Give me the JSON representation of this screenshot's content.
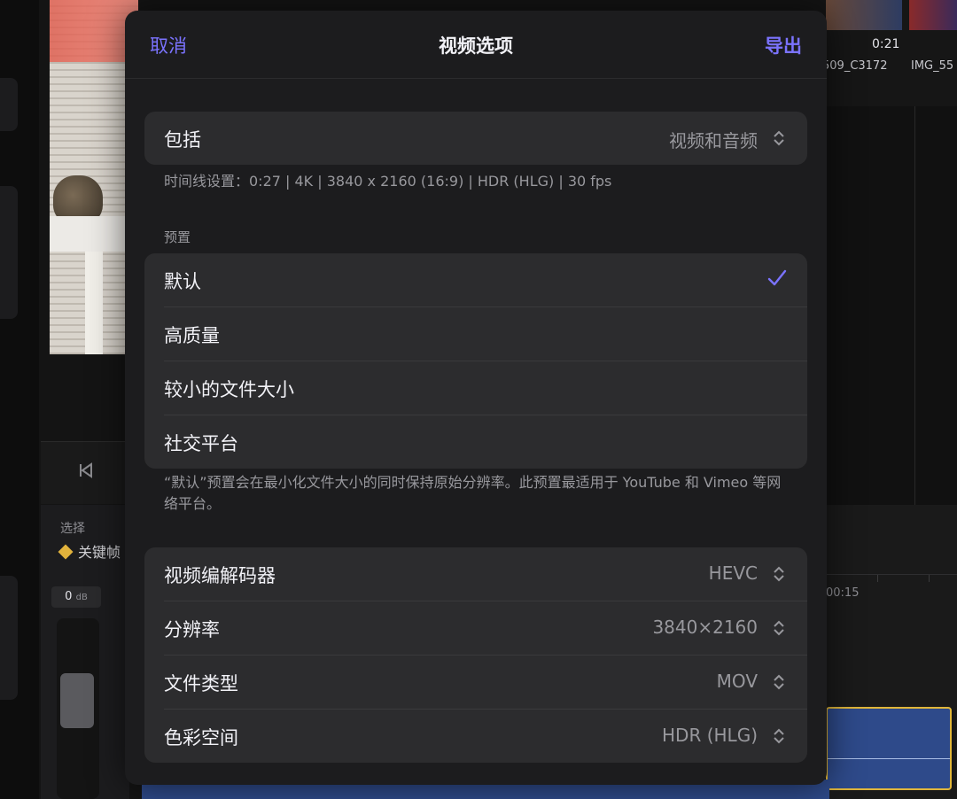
{
  "background": {
    "keyframe_label": "选择",
    "keyframe_text": "关键帧",
    "db_value": "0",
    "db_unit": "dB",
    "clip_duration": "0:21",
    "clip_name_1": "509_C3172",
    "clip_name_2": "IMG_55",
    "timecode": "00:15"
  },
  "dialog": {
    "cancel_label": "取消",
    "title": "视频选项",
    "export_label": "导出",
    "include": {
      "label": "包括",
      "value": "视频和音频"
    },
    "timeline_settings": "时间线设置：0:27 | 4K | 3840 x 2160 (16:9) | HDR (HLG) | 30 fps",
    "preset_header": "预置",
    "presets": [
      {
        "label": "默认",
        "selected": true
      },
      {
        "label": "高质量",
        "selected": false
      },
      {
        "label": "较小的文件大小",
        "selected": false
      },
      {
        "label": "社交平台",
        "selected": false
      }
    ],
    "preset_description": "“默认”预置会在最小化文件大小的同时保持原始分辨率。此预置最适用于 YouTube 和 Vimeo 等网络平台。",
    "settings": [
      {
        "label": "视频编解码器",
        "value": "HEVC"
      },
      {
        "label": "分辨率",
        "value": "3840×2160"
      },
      {
        "label": "文件类型",
        "value": "MOV"
      },
      {
        "label": "色彩空间",
        "value": "HDR (HLG)"
      }
    ]
  },
  "colors": {
    "accent": "#7b73ff",
    "dialog_bg": "#1c1c1e",
    "group_bg": "#2c2c2e",
    "secondary_text": "#98989d"
  },
  "icons": {
    "chevron": "chevron-up-down-icon",
    "checkmark": "checkmark-icon",
    "transport": "skip-back-icon",
    "keyframe": "keyframe-diamond-icon"
  }
}
